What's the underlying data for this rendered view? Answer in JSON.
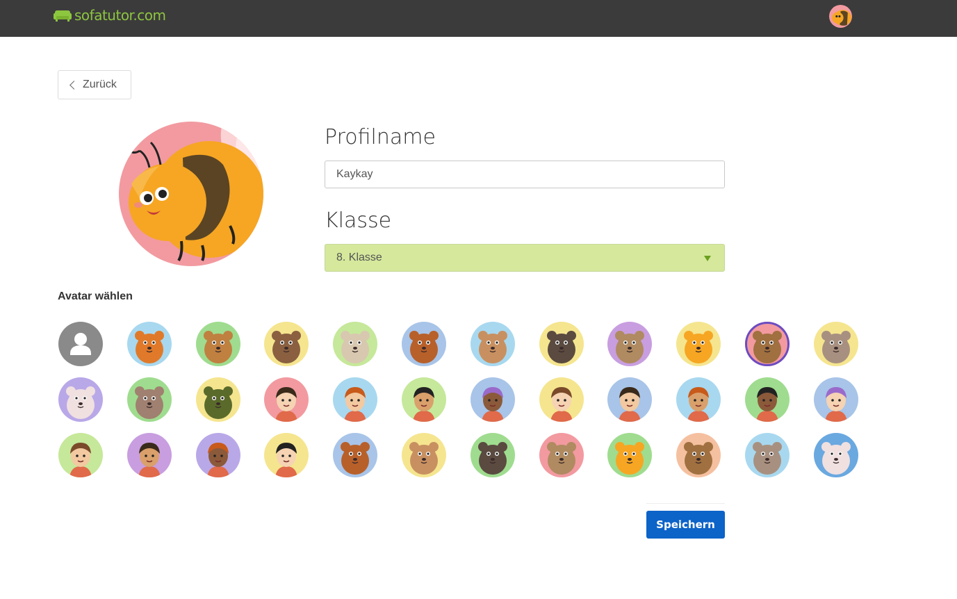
{
  "header": {
    "logo_text": "sofatutor.com",
    "logo_color": "#8dc63f",
    "background": "#3b3b3b",
    "user_avatar_icon": "bee-avatar-icon"
  },
  "back_button": {
    "label": "Zurück",
    "icon": "chevron-left-icon"
  },
  "profile": {
    "selected_avatar_icon": "bee-avatar-icon",
    "name_label": "Profilname",
    "name_value": "Kaykay",
    "class_label": "Klasse",
    "class_value": "8. Klasse",
    "class_select_color": "#d5e89c"
  },
  "avatar_section": {
    "title": "Avatar wählen",
    "selected_index": 10,
    "avatars": [
      {
        "name": "default-user-icon",
        "bg": "#8a8a8a"
      },
      {
        "name": "pig-avatar-icon",
        "bg": "#a8d8ef"
      },
      {
        "name": "fox-avatar-icon",
        "bg": "#9fdc8f"
      },
      {
        "name": "dog-avatar-icon",
        "bg": "#f5e58f"
      },
      {
        "name": "beaver-avatar-icon",
        "bg": "#c6e89a"
      },
      {
        "name": "raccoon-avatar-icon",
        "bg": "#a8c4e8"
      },
      {
        "name": "lion-avatar-icon",
        "bg": "#a8d8ef"
      },
      {
        "name": "horse-avatar-icon",
        "bg": "#f5e58f"
      },
      {
        "name": "mole-avatar-icon",
        "bg": "#c89ee0"
      },
      {
        "name": "kangaroo-avatar-icon",
        "bg": "#f5e58f"
      },
      {
        "name": "bee-avatar-icon",
        "bg": "#f29aa0"
      },
      {
        "name": "squirrel-avatar-icon",
        "bg": "#f5e58f"
      },
      {
        "name": "mouse-avatar-icon",
        "bg": "#b9a8e8"
      },
      {
        "name": "cat-glasses-avatar-icon",
        "bg": "#9fdc8f"
      },
      {
        "name": "hippo-avatar-icon",
        "bg": "#f5e58f"
      },
      {
        "name": "girl-pigtails-avatar-icon",
        "bg": "#f29aa0"
      },
      {
        "name": "boy-redhair-avatar-icon",
        "bg": "#a8d8ef"
      },
      {
        "name": "boy-dark-avatar-icon",
        "bg": "#c6e89a"
      },
      {
        "name": "girl-longhair-avatar-icon",
        "bg": "#a8c4e8"
      },
      {
        "name": "explorer-avatar-icon",
        "bg": "#f5e58f"
      },
      {
        "name": "girl-redhat-avatar-icon",
        "bg": "#a8c4e8"
      },
      {
        "name": "girl-brownhair-avatar-icon",
        "bg": "#a8d8ef"
      },
      {
        "name": "boy-mustache-avatar-icon",
        "bg": "#9fdc8f"
      },
      {
        "name": "boy-blackhair-avatar-icon",
        "bg": "#a8c4e8"
      },
      {
        "name": "girl-purplehair-avatar-icon",
        "bg": "#c6e89a"
      },
      {
        "name": "girl-curly-avatar-icon",
        "bg": "#c89ee0"
      },
      {
        "name": "boy-orange-avatar-icon",
        "bg": "#b9a8e8"
      },
      {
        "name": "boy-afro-avatar-icon",
        "bg": "#f5e58f"
      },
      {
        "name": "alien-avatar-icon",
        "bg": "#a8c4e8"
      },
      {
        "name": "vampire-avatar-icon",
        "bg": "#f5e58f"
      },
      {
        "name": "dragon-avatar-icon",
        "bg": "#9fdc8f"
      },
      {
        "name": "zombie-avatar-icon",
        "bg": "#f29aa0"
      },
      {
        "name": "witch-avatar-icon",
        "bg": "#9fdc8f"
      },
      {
        "name": "shark-avatar-icon",
        "bg": "#f5c0a0"
      },
      {
        "name": "unicorn-avatar-icon",
        "bg": "#a8d8ef"
      },
      {
        "name": "penguin-avatar-icon",
        "bg": "#6aa8e0"
      }
    ]
  },
  "actions": {
    "save_label": "Speichern",
    "save_color": "#0c63c8"
  }
}
